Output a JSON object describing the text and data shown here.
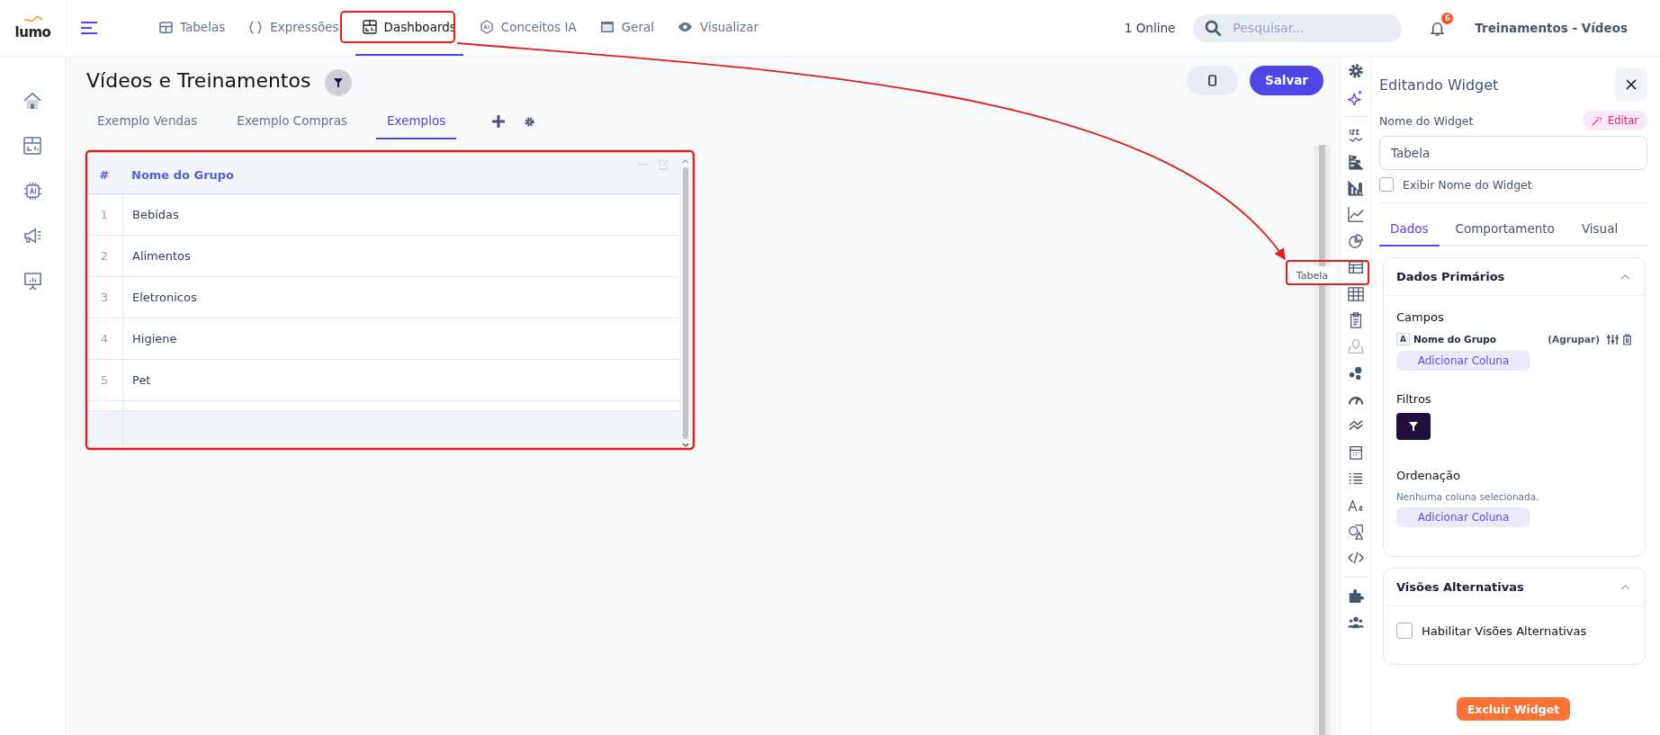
{
  "brand": {
    "logo": "lumo"
  },
  "top_nav": [
    {
      "label": "Tabelas",
      "kind": "table",
      "selected": false
    },
    {
      "label": "Expressões",
      "kind": "braces",
      "selected": false
    },
    {
      "label": "Dashboards",
      "kind": "dashboard",
      "selected": true
    },
    {
      "label": "Conceitos IA",
      "kind": "ai",
      "selected": false
    },
    {
      "label": "Geral",
      "kind": "window",
      "selected": false
    },
    {
      "label": "Visualizar",
      "kind": "eye",
      "selected": false
    }
  ],
  "online": "1 Online",
  "search": {
    "placeholder": "Pesquisar..."
  },
  "notifications": {
    "count": "6"
  },
  "workspace": "Treinamentos - Vídeos",
  "dashboard": {
    "title": "Vídeos e Treinamentos",
    "save_button": "Salvar",
    "tabs": [
      {
        "label": "Exemplo Vendas",
        "selected": false
      },
      {
        "label": "Exemplo Compras",
        "selected": false
      },
      {
        "label": "Exemplos",
        "selected": true
      }
    ]
  },
  "table": {
    "columns": [
      "#",
      "Nome do Grupo"
    ],
    "rows": [
      [
        "1",
        "Bebidas"
      ],
      [
        "2",
        "Alimentos"
      ],
      [
        "3",
        "Eletronicos"
      ],
      [
        "4",
        "Higiene"
      ],
      [
        "5",
        "Pet"
      ]
    ]
  },
  "widget_tooltip": "Tabela",
  "editor": {
    "title": "Editando Widget",
    "name_label": "Nome do Widget",
    "edit_button": "Editar",
    "name_value": "Tabela",
    "show_name": {
      "label": "Exibir Nome do Widget",
      "checked": false
    },
    "tabs": [
      {
        "label": "Dados",
        "selected": true
      },
      {
        "label": "Comportamento",
        "selected": false
      },
      {
        "label": "Visual",
        "selected": false
      }
    ],
    "primary": {
      "title": "Dados Primários",
      "expanded": true,
      "fields_label": "Campos",
      "fields": [
        {
          "type": "A",
          "name": "Nome do Grupo",
          "mode": "(Agrupar)"
        }
      ],
      "add_field": "Adicionar Coluna",
      "filters_label": "Filtros",
      "sort_label": "Ordenação",
      "sort_empty": "Nenhuma coluna selecionada.",
      "add_sort": "Adicionar Coluna"
    },
    "alternative": {
      "title": "Visões Alternativas",
      "expanded": true,
      "option": {
        "label": "Habilitar Visões Alternativas",
        "checked": false
      }
    },
    "delete_button": "Excluir Widget"
  }
}
